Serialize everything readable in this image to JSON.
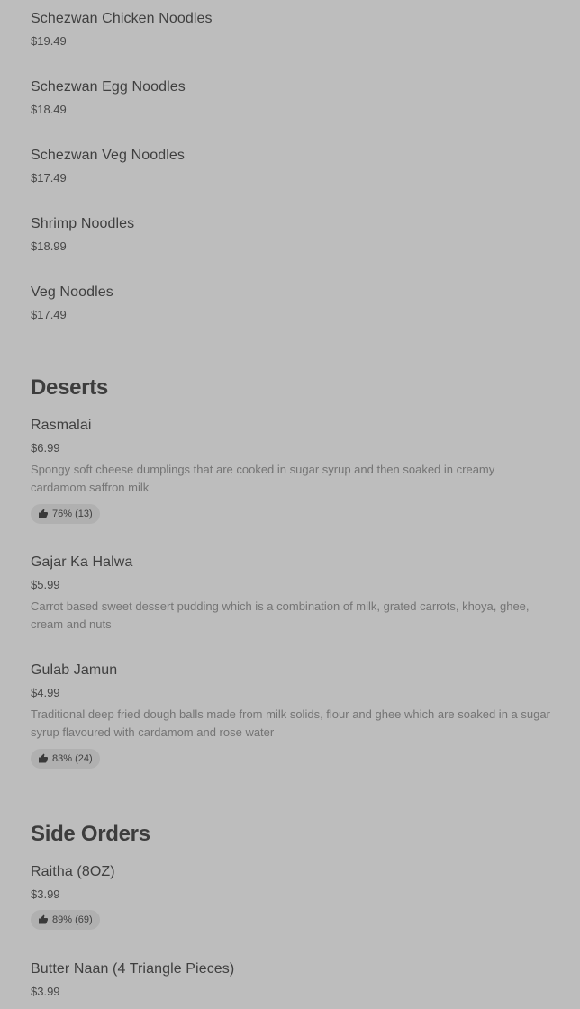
{
  "noodles": [
    {
      "name": "Schezwan Chicken Noodles",
      "price": "$19.49"
    },
    {
      "name": "Schezwan Egg Noodles",
      "price": "$18.49"
    },
    {
      "name": "Schezwan Veg Noodles",
      "price": "$17.49"
    },
    {
      "name": "Shrimp Noodles",
      "price": "$18.99"
    },
    {
      "name": "Veg Noodles",
      "price": "$17.49"
    }
  ],
  "deserts": {
    "title": "Deserts",
    "items": [
      {
        "name": "Rasmalai",
        "price": "$6.99",
        "description": "Spongy soft cheese dumplings that are cooked in sugar syrup and then soaked in creamy cardamom saffron milk",
        "rating": "76% (13)"
      },
      {
        "name": "Gajar Ka Halwa",
        "price": "$5.99",
        "description": "Carrot based sweet dessert pudding which is a combination of milk, grated carrots, khoya, ghee, cream and nuts"
      },
      {
        "name": "Gulab Jamun",
        "price": "$4.99",
        "description": "Traditional deep fried dough balls made from milk solids, flour and ghee which are soaked in a sugar syrup flavoured with cardamom and rose water",
        "rating": "83% (24)"
      }
    ]
  },
  "side_orders": {
    "title": "Side Orders",
    "items": [
      {
        "name": "Raitha (8OZ)",
        "price": "$3.99",
        "rating": "89% (69)"
      },
      {
        "name": "Butter Naan (4 Triangle Pieces)",
        "price": "$3.99"
      }
    ]
  },
  "icons": {
    "rating": "thumbs-up-icon"
  }
}
